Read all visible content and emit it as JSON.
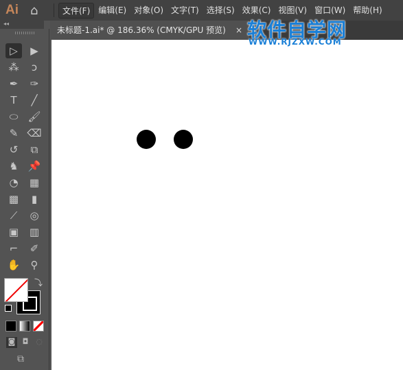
{
  "app": {
    "logo": "Ai",
    "home_icon": "home-icon"
  },
  "menu": [
    "文件(F)",
    "编辑(E)",
    "对象(O)",
    "文字(T)",
    "选择(S)",
    "效果(C)",
    "视图(V)",
    "窗口(W)",
    "帮助(H)"
  ],
  "panel": {
    "collapse": "◂◂"
  },
  "tab": {
    "title": "未标题-1.ai* @ 186.36% (CMYK/GPU 预览)",
    "close": "×"
  },
  "watermark": {
    "text": "软件自学网",
    "url": "WWW.RJZXW.COM"
  },
  "tools": [
    [
      "selection-tool",
      "▷"
    ],
    [
      "direct-selection-tool",
      "▶"
    ],
    [
      "magic-wand-tool",
      "⁂"
    ],
    [
      "lasso-tool",
      "ↄ"
    ],
    [
      "pen-tool",
      "✒"
    ],
    [
      "curvature-tool",
      "✑"
    ],
    [
      "type-tool",
      "T"
    ],
    [
      "line-tool",
      "╱"
    ],
    [
      "ellipse-tool",
      "⬭"
    ],
    [
      "paintbrush-tool",
      "🖌"
    ],
    [
      "pencil-tool",
      "✎"
    ],
    [
      "eraser-tool",
      "⌫"
    ],
    [
      "rotate-tool",
      "↺"
    ],
    [
      "scale-tool",
      "⧉"
    ],
    [
      "puppet-warp-tool",
      "♞"
    ],
    [
      "pin-tool",
      "📌"
    ],
    [
      "shape-builder-tool",
      "◔"
    ],
    [
      "perspective-grid-tool",
      "▦"
    ],
    [
      "mesh-tool",
      "▩"
    ],
    [
      "gradient-tool",
      "▮"
    ],
    [
      "eyedropper-tool",
      "⟋"
    ],
    [
      "blend-tool",
      "◎"
    ],
    [
      "symbol-sprayer-tool",
      "▣"
    ],
    [
      "column-graph-tool",
      "▥"
    ],
    [
      "artboard-tool",
      "⌐"
    ],
    [
      "slice-tool",
      "✐"
    ],
    [
      "hand-tool",
      "✋"
    ],
    [
      "zoom-tool",
      "⚲"
    ]
  ],
  "colors": {
    "fill": "#ffffff",
    "stroke": "#000000",
    "none_slash": "#ff0000",
    "watermark": "#1a7fd6"
  }
}
